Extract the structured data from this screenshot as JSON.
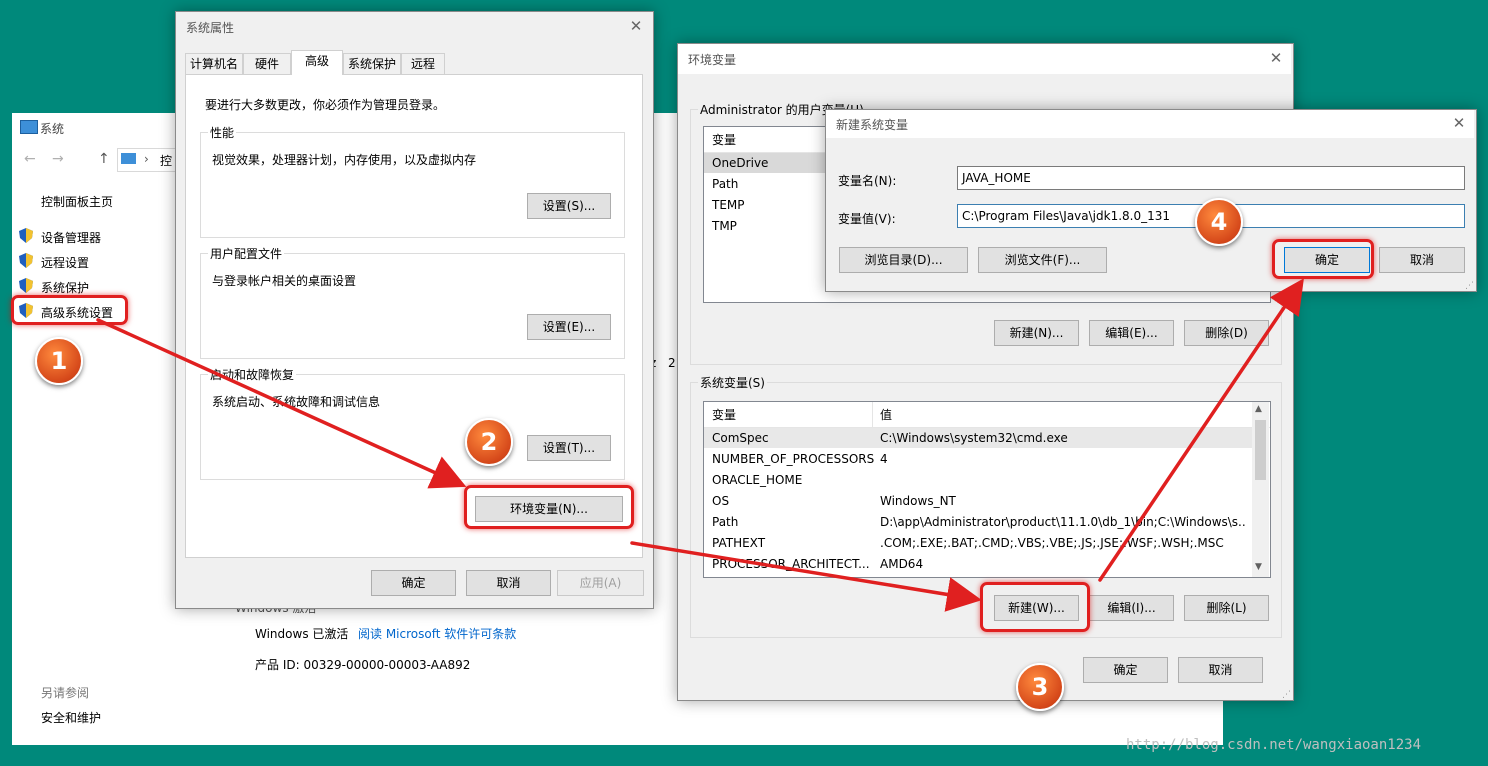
{
  "system_window": {
    "title": "系统",
    "address_partial": "控",
    "sidebar_home": "控制面板主页",
    "sidebar_links": [
      "设备管理器",
      "远程设置",
      "系统保护",
      "高级系统设置"
    ],
    "see_also_heading": "另请参阅",
    "see_also_link": "安全和维护",
    "activation_heading": "Windows 激活",
    "activation_status": "Windows 已激活",
    "license_link": "阅读 Microsoft 软件许可条款",
    "product_id": "产品 ID: 00329-00000-00003-AA892",
    "partial_text_1": "z",
    "partial_text_2": "2"
  },
  "sysprops": {
    "title": "系统属性",
    "tabs": [
      "计算机名",
      "硬件",
      "高级",
      "系统保护",
      "远程"
    ],
    "active_tab": "高级",
    "admin_note": "要进行大多数更改，你必须作为管理员登录。",
    "performance": {
      "label": "性能",
      "desc": "视觉效果，处理器计划，内存使用，以及虚拟内存",
      "button": "设置(S)..."
    },
    "user_profiles": {
      "label": "用户配置文件",
      "desc": "与登录帐户相关的桌面设置",
      "button": "设置(E)..."
    },
    "startup": {
      "label": "启动和故障恢复",
      "desc": "系统启动、系统故障和调试信息",
      "button": "设置(T)..."
    },
    "env_button": "环境变量(N)...",
    "ok": "确定",
    "cancel": "取消",
    "apply": "应用(A)"
  },
  "envvars": {
    "title": "环境变量",
    "user_group_label": "Administrator 的用户变量(U)",
    "user_header_var": "变量",
    "user_vars": [
      "OneDrive",
      "Path",
      "TEMP",
      "TMP"
    ],
    "user_new": "新建(N)...",
    "user_edit": "编辑(E)...",
    "user_delete": "删除(D)",
    "sys_group_label": "系统变量(S)",
    "sys_header_var": "变量",
    "sys_header_val": "值",
    "sys_vars": [
      {
        "name": "ComSpec",
        "value": "C:\\Windows\\system32\\cmd.exe"
      },
      {
        "name": "NUMBER_OF_PROCESSORS",
        "value": "4"
      },
      {
        "name": "ORACLE_HOME",
        "value": ""
      },
      {
        "name": "OS",
        "value": "Windows_NT"
      },
      {
        "name": "Path",
        "value": "D:\\app\\Administrator\\product\\11.1.0\\db_1\\bin;C:\\Windows\\s..."
      },
      {
        "name": "PATHEXT",
        "value": ".COM;.EXE;.BAT;.CMD;.VBS;.VBE;.JS;.JSE;.WSF;.WSH;.MSC"
      },
      {
        "name": "PROCESSOR_ARCHITECT...",
        "value": "AMD64"
      }
    ],
    "sys_new": "新建(W)...",
    "sys_edit": "编辑(I)...",
    "sys_delete": "删除(L)",
    "ok": "确定",
    "cancel": "取消"
  },
  "newvar": {
    "title": "新建系统变量",
    "name_label": "变量名(N):",
    "name_value": "JAVA_HOME",
    "value_label": "变量值(V):",
    "value_value": "C:\\Program Files\\Java\\jdk1.8.0_131",
    "browse_dir": "浏览目录(D)...",
    "browse_file": "浏览文件(F)...",
    "ok": "确定",
    "cancel": "取消"
  },
  "step_badges": [
    "1",
    "2",
    "3",
    "4"
  ],
  "watermark": "http://blog.csdn.net/wangxiaoan1234",
  "colors": {
    "background": "#00897b",
    "highlight": "#e02020",
    "badge": "#e0561f",
    "link": "#0066cc",
    "shield": "#1f5fbf"
  }
}
